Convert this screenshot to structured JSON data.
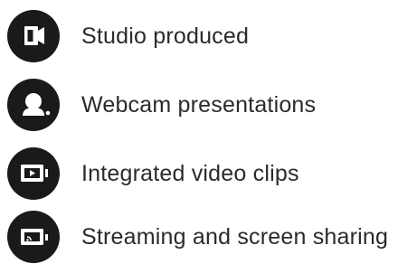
{
  "features": [
    {
      "icon": "studio-camera-icon",
      "label": "Studio produced"
    },
    {
      "icon": "webcam-person-icon",
      "label": "Webcam presentations"
    },
    {
      "icon": "video-clip-icon",
      "label": "Integrated video clips"
    },
    {
      "icon": "screen-share-icon",
      "label": "Streaming and screen sharing"
    }
  ],
  "colors": {
    "icon_background": "#1a1a1a",
    "icon_foreground": "#ffffff",
    "text": "#2b2b2b"
  }
}
